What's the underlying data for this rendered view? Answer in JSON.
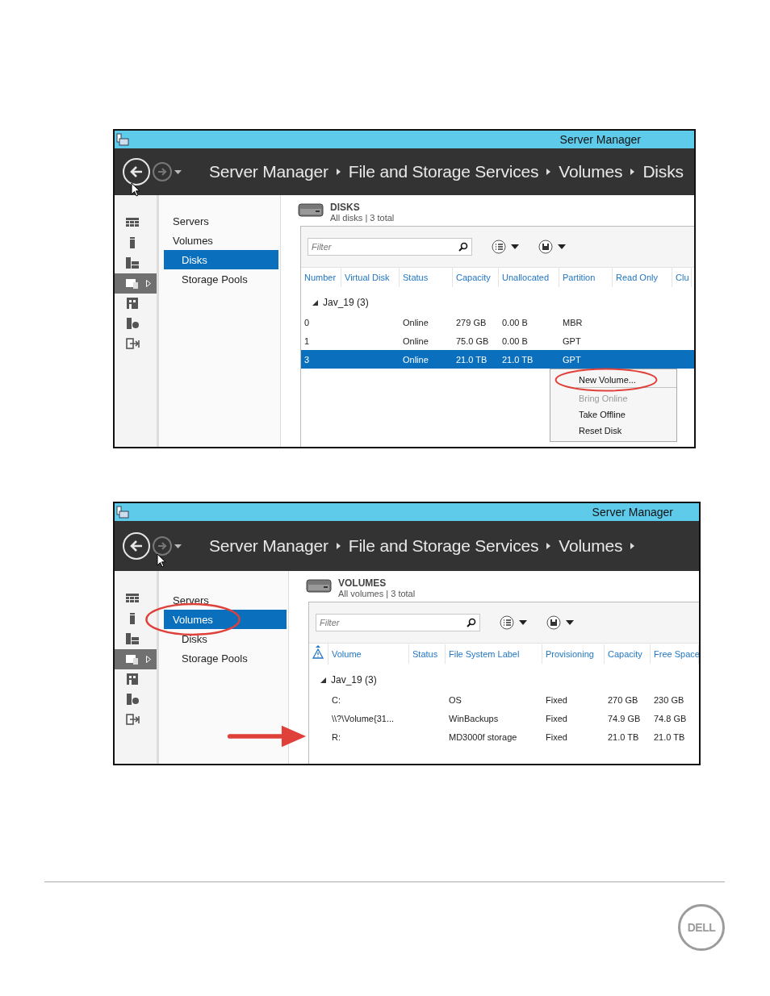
{
  "screenshots": [
    {
      "window_title": "Server Manager",
      "forward_enabled": false,
      "breadcrumb": [
        "Server Manager",
        "File and Storage Services",
        "Volumes",
        "Disks"
      ],
      "trailing_separator": false,
      "rail": [
        {
          "selected": false
        },
        {
          "selected": false
        },
        {
          "selected": false
        },
        {
          "selected": true
        },
        {
          "selected": false
        },
        {
          "selected": false
        },
        {
          "selected": false
        }
      ],
      "nav": [
        {
          "label": "Servers",
          "selected": false,
          "circled": false
        },
        {
          "label": "Volumes",
          "selected": false,
          "circled": false,
          "children": [
            {
              "label": "Disks",
              "selected": true,
              "circled": false
            },
            {
              "label": "Storage Pools",
              "selected": false,
              "circled": false
            }
          ]
        }
      ],
      "section": {
        "title": "DISKS",
        "subtitle": "All disks | 3 total"
      },
      "filter": {
        "placeholder": "Filter"
      },
      "table": {
        "icon_column": false,
        "columns": [
          "Number",
          "Virtual Disk",
          "Status",
          "Capacity",
          "Unallocated",
          "Partition",
          "Read Only",
          "Clu"
        ],
        "group": {
          "label": "Jav_19 (3)",
          "expanded": true
        },
        "rows": [
          {
            "cells": [
              "0",
              null,
              "Online",
              "279 GB",
              "0.00 B",
              "MBR",
              null,
              null
            ],
            "selected": false,
            "arrow": false
          },
          {
            "cells": [
              "1",
              null,
              "Online",
              "75.0 GB",
              "0.00 B",
              "GPT",
              null,
              null
            ],
            "selected": false,
            "arrow": false
          },
          {
            "cells": [
              "3",
              null,
              "Online",
              "21.0 TB",
              "21.0 TB",
              "GPT",
              null,
              null
            ],
            "selected": true,
            "arrow": false
          }
        ],
        "context_menu": [
          {
            "label": "New Volume...",
            "disabled": false,
            "circled": true,
            "separator_after": true
          },
          {
            "label": "Bring Online",
            "disabled": true,
            "circled": false,
            "separator_after": false
          },
          {
            "label": "Take Offline",
            "disabled": false,
            "circled": false,
            "separator_after": false
          },
          {
            "label": "Reset Disk",
            "disabled": false,
            "circled": false,
            "separator_after": false
          }
        ]
      }
    },
    {
      "window_title": "Server Manager",
      "forward_enabled": false,
      "breadcrumb": [
        "Server Manager",
        "File and Storage Services",
        "Volumes"
      ],
      "trailing_separator": true,
      "rail": [
        {
          "selected": false
        },
        {
          "selected": false
        },
        {
          "selected": false
        },
        {
          "selected": true
        },
        {
          "selected": false
        },
        {
          "selected": false
        },
        {
          "selected": false
        }
      ],
      "nav": [
        {
          "label": "Servers",
          "selected": false,
          "circled": false
        },
        {
          "label": "Volumes",
          "selected": true,
          "circled": true,
          "children": [
            {
              "label": "Disks",
              "selected": false,
              "circled": false
            },
            {
              "label": "Storage Pools",
              "selected": false,
              "circled": false
            }
          ]
        }
      ],
      "section": {
        "title": "VOLUMES",
        "subtitle": "All volumes | 3 total"
      },
      "filter": {
        "placeholder": "Filter"
      },
      "table": {
        "icon_column": true,
        "columns": [
          "Volume",
          "Status",
          "File System Label",
          "Provisioning",
          "Capacity",
          "Free Space"
        ],
        "group": {
          "label": "Jav_19 (3)",
          "expanded": true
        },
        "rows": [
          {
            "cells": [
              "C:",
              null,
              "OS",
              "Fixed",
              "270 GB",
              "230 GB"
            ],
            "selected": false,
            "arrow": false
          },
          {
            "cells": [
              "\\\\?\\Volume{31...",
              null,
              "WinBackups",
              "Fixed",
              "74.9 GB",
              "74.8 GB"
            ],
            "selected": false,
            "arrow": false
          },
          {
            "cells": [
              "R:",
              null,
              "MD3000f storage",
              "Fixed",
              "21.0 TB",
              "21.0 TB"
            ],
            "selected": false,
            "arrow": true
          }
        ]
      }
    }
  ],
  "footer": {
    "logo_text": "DELL"
  }
}
